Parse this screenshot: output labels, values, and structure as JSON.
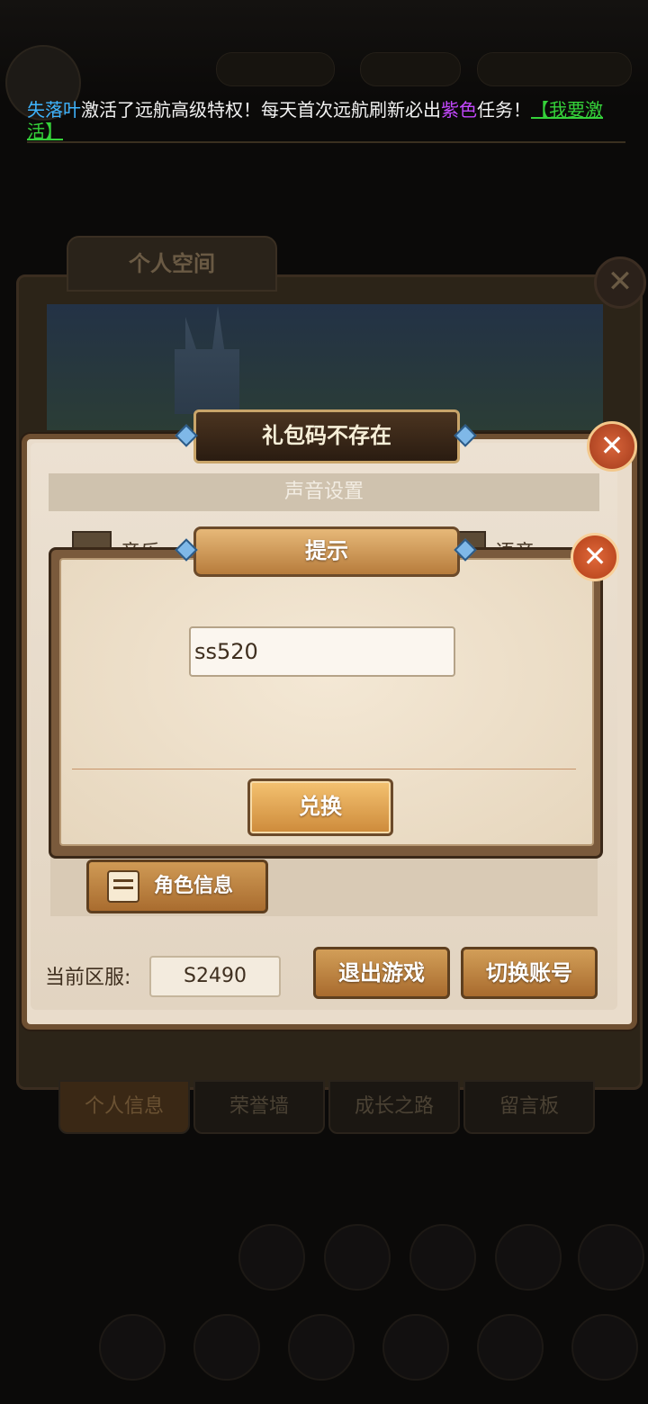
{
  "notice": {
    "player": "失落叶",
    "text1": "激活了远航高级特权！每天首次远航刷新必出",
    "highlight": "紫色",
    "text2": "任务！",
    "link": "【我要激活】"
  },
  "personal_space": {
    "tab_title": "个人空间",
    "bottom_tabs": [
      "个人信息",
      "荣誉墙",
      "成长之路",
      "留言板"
    ]
  },
  "system_settings": {
    "title": "礼包码不存在",
    "sound_section": "声音设置",
    "music_label": "音乐",
    "voice_label": "语音",
    "role_info_button": "角色信息",
    "server_label": "当前区服:",
    "server_value": "S2490",
    "exit_button": "退出游戏",
    "switch_account_button": "切换账号"
  },
  "prompt_dialog": {
    "title": "提示",
    "code_value": "ss520",
    "redeem_button": "兑换"
  },
  "colors": {
    "player_name": "#3fb5ff",
    "highlight": "#c448ff",
    "link": "#35d23a"
  }
}
